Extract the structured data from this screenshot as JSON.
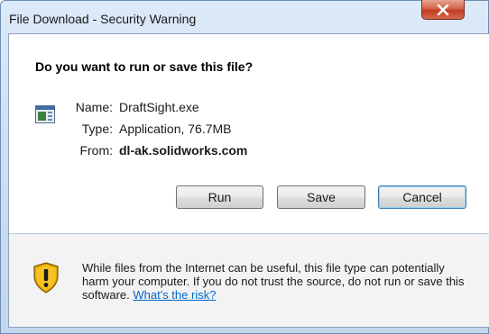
{
  "window": {
    "title": "File Download - Security Warning"
  },
  "question": "Do you want to run or save this file?",
  "file": {
    "name_label": "Name:",
    "name_value": "DraftSight.exe",
    "type_label": "Type:",
    "type_value": "Application, 76.7MB",
    "from_label": "From:",
    "from_value": "dl-ak.solidworks.com"
  },
  "buttons": {
    "run": "Run",
    "save": "Save",
    "cancel": "Cancel"
  },
  "warning": {
    "text": "While files from the Internet can be useful, this file type can potentially harm your computer. If you do not trust the source, do not run or save this software.",
    "link": "What's the risk?"
  },
  "icons": {
    "close": "close-icon",
    "file": "application-file-icon",
    "shield": "security-shield-icon"
  },
  "colors": {
    "link": "#0066cc",
    "close_button": "#c23d22",
    "default_button_border": "#3c7fb1"
  }
}
